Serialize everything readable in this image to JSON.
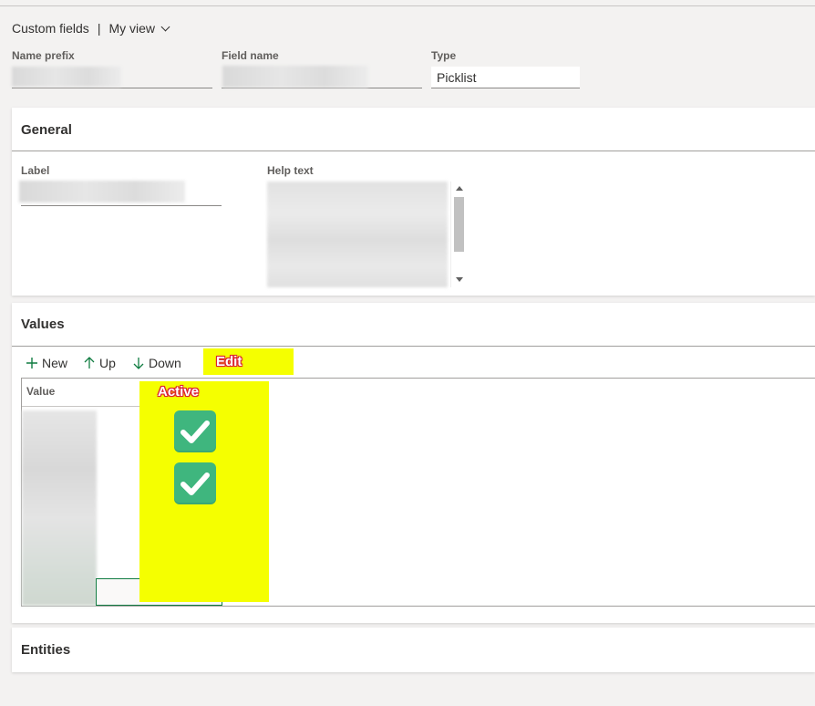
{
  "viewbar": {
    "title": "Custom fields",
    "separator": "|",
    "view": "My view"
  },
  "header_fields": {
    "name_prefix": {
      "label": "Name prefix"
    },
    "field_name": {
      "label": "Field name"
    },
    "type": {
      "label": "Type",
      "value": "Picklist"
    }
  },
  "general": {
    "title": "General",
    "label_field": {
      "label": "Label"
    },
    "help_text": {
      "label": "Help text"
    }
  },
  "values": {
    "title": "Values",
    "toolbar": {
      "new": "New",
      "up": "Up",
      "down": "Down"
    },
    "annotation_edit": "Edit",
    "annotation_active": "Active",
    "columns": [
      "Value"
    ],
    "rows": [
      {
        "active": true
      },
      {
        "active": true
      }
    ],
    "colors": {
      "highlight": "#f5ff00",
      "checkbox": "#3fb67e",
      "annotation_outline": "#dd2233"
    }
  },
  "entities": {
    "title": "Entities"
  }
}
